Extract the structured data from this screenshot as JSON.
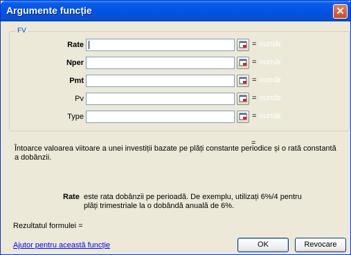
{
  "title": "Argumente funcție",
  "close_symbol": "✕",
  "function_name": "FV",
  "args": [
    {
      "label": "Rate",
      "bold": true,
      "value": "",
      "equals": "=",
      "result": "număr"
    },
    {
      "label": "Nper",
      "bold": true,
      "value": "",
      "equals": "=",
      "result": "număr"
    },
    {
      "label": "Pmt",
      "bold": true,
      "value": "",
      "equals": "=",
      "result": "număr"
    },
    {
      "label": "Pv",
      "bold": false,
      "value": "",
      "equals": "=",
      "result": "număr"
    },
    {
      "label": "Type",
      "bold": false,
      "value": "",
      "equals": "=",
      "result": "număr"
    }
  ],
  "result_equals": "=",
  "description": "Întoarce valoarea viitoare a unei investiții bazate pe plăți constante periodice și o rată constantă a dobânzii.",
  "current_arg": {
    "name": "Rate",
    "text": "este rata dobânzii pe perioadă. De exemplu, utilizați 6%/4 pentru plăți trimestriale la o dobândă anuală de 6%."
  },
  "formula_result": "Rezultatul formulei =",
  "help_link": "Ajutor pentru această funcție",
  "ok_label": "OK",
  "cancel_label": "Revocare",
  "icons": {
    "close": "close-icon",
    "collapse": "collapse-dialog-icon"
  },
  "colors": {
    "titlebar": "#0054e3",
    "link": "#0000ff",
    "group_label": "#0046d5"
  }
}
